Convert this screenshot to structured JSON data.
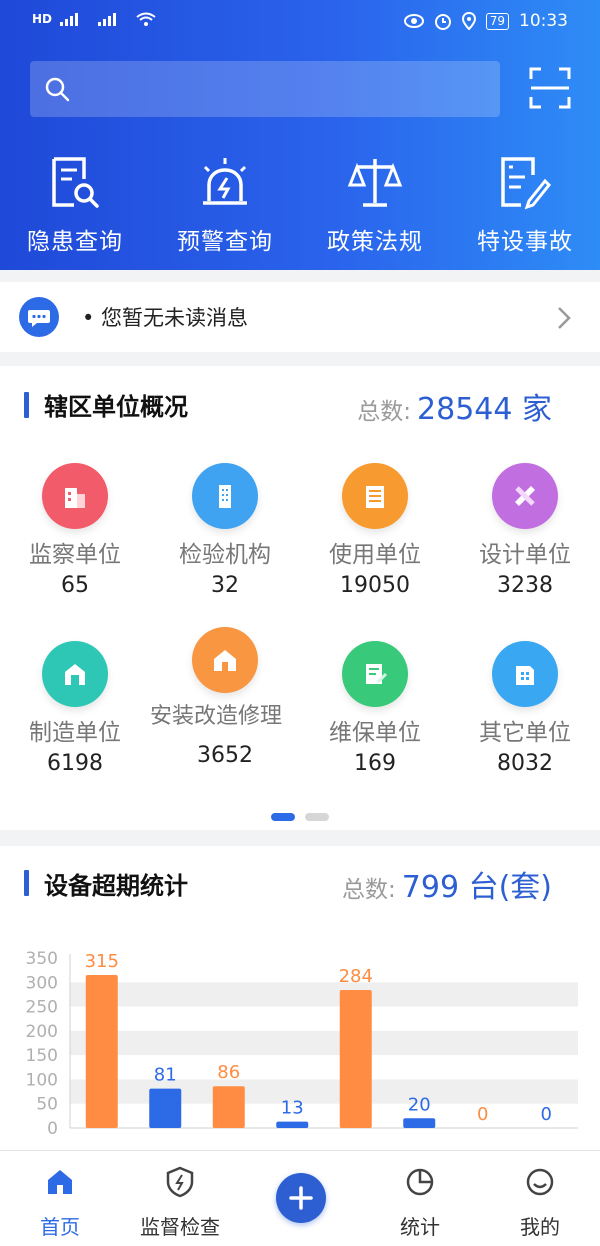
{
  "status_bar": {
    "left_text": "HD",
    "battery": "79",
    "time": "10:33"
  },
  "quick_actions": [
    {
      "label": "隐患查询",
      "icon": "document-search-icon"
    },
    {
      "label": "预警查询",
      "icon": "alarm-light-icon"
    },
    {
      "label": "政策法规",
      "icon": "scales-icon"
    },
    {
      "label": "特设事故",
      "icon": "report-edit-icon"
    }
  ],
  "messages": {
    "text": "• 您暂无未读消息"
  },
  "units_section": {
    "title": "辖区单位概况",
    "total_label": "总数:",
    "total_value": "28544 家",
    "units": [
      {
        "name": "监察单位",
        "count": "65",
        "color": "#f25c6a",
        "icon": "building-icon"
      },
      {
        "name": "检验机构",
        "count": "32",
        "color": "#3fa3f2",
        "icon": "tower-icon"
      },
      {
        "name": "使用单位",
        "count": "19050",
        "color": "#f79a2f",
        "icon": "office-icon"
      },
      {
        "name": "设计单位",
        "count": "3238",
        "color": "#c16ee0",
        "icon": "ruler-pencil-icon"
      },
      {
        "name": "制造单位",
        "count": "6198",
        "color": "#2ec7b6",
        "icon": "factory-icon"
      },
      {
        "name": "安装改造修理",
        "count": "3652",
        "color": "#f89641",
        "icon": "house-tools-icon"
      },
      {
        "name": "维保单位",
        "count": "169",
        "color": "#38c97b",
        "icon": "maintenance-icon"
      },
      {
        "name": "其它单位",
        "count": "8032",
        "color": "#3aa7f2",
        "icon": "other-building-icon"
      }
    ]
  },
  "equipment_section": {
    "title": "设备超期统计",
    "total_label": "总数:",
    "total_value": "799 台(套)"
  },
  "chart_data": {
    "type": "bar",
    "ylim": [
      0,
      350
    ],
    "yticks": [
      0,
      50,
      100,
      150,
      200,
      250,
      300,
      350
    ],
    "values": [
      315,
      81,
      86,
      13,
      284,
      20,
      0,
      0
    ],
    "bar_colors": [
      "#ff8c42",
      "#2d6be6",
      "#ff8c42",
      "#2d6be6",
      "#ff8c42",
      "#2d6be6",
      "#ff8c42",
      "#2d6be6"
    ],
    "grid": true
  },
  "tabbar": {
    "items": [
      {
        "label": "首页",
        "icon": "home-icon"
      },
      {
        "label": "监督检查",
        "icon": "shield-bolt-icon"
      },
      {
        "label": "统计",
        "icon": "pie-chart-icon"
      },
      {
        "label": "我的",
        "icon": "smile-icon"
      }
    ],
    "center_icon": "plus-icon"
  },
  "colors": {
    "primary": "#2d5fd3",
    "accent_orange": "#ff8c42"
  }
}
